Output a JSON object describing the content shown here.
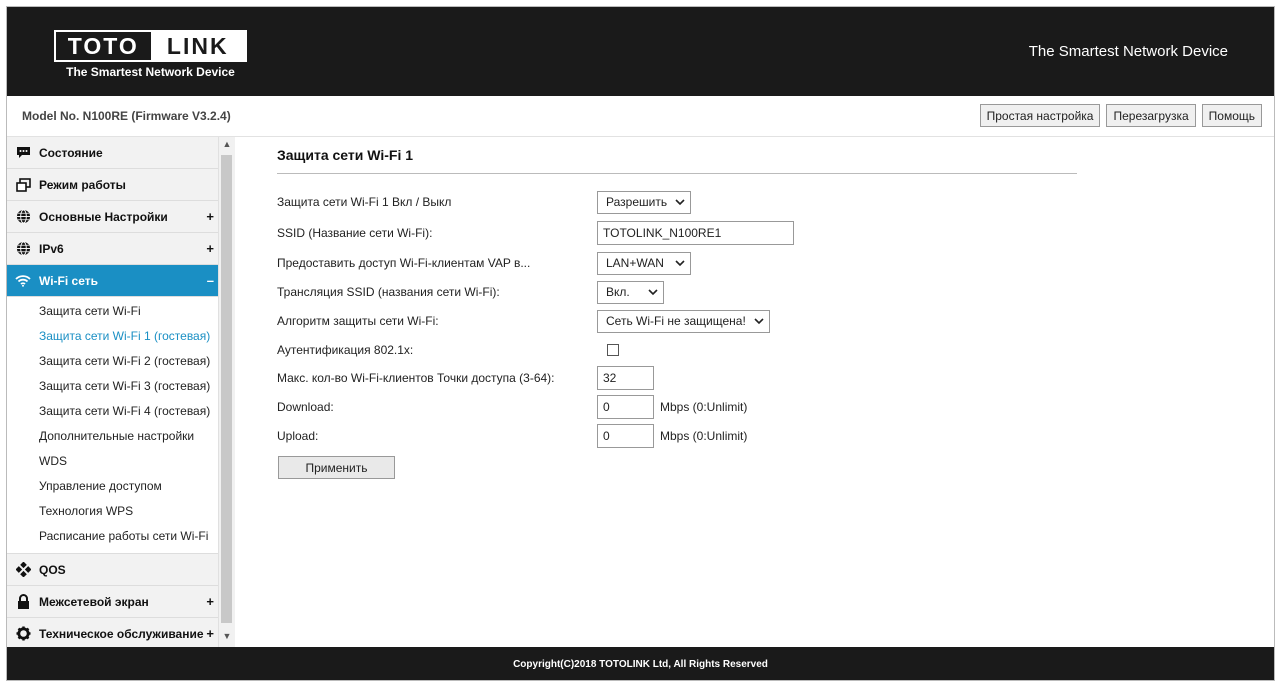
{
  "header": {
    "logo_left": "TOTO",
    "logo_right": "LINK",
    "logo_sub": "The Smartest Network Device",
    "slogan": "The Smartest Network Device"
  },
  "modelbar": {
    "model": "Model No. N100RE (Firmware V3.2.4)",
    "buttons": [
      "Простая настройка",
      "Перезагрузка",
      "Помощь"
    ]
  },
  "sidebar": {
    "items": [
      {
        "label": "Состояние",
        "icon": "chat-icon",
        "expander": ""
      },
      {
        "label": "Режим работы",
        "icon": "windows-icon",
        "expander": ""
      },
      {
        "label": "Основные Настройки",
        "icon": "globe-icon",
        "expander": "+"
      },
      {
        "label": "IPv6",
        "icon": "globe-icon",
        "expander": "+"
      },
      {
        "label": "Wi-Fi сеть",
        "icon": "wifi-icon",
        "expander": "–"
      }
    ],
    "wifi_sub": [
      "Защита сети Wi-Fi",
      "Защита сети Wi-Fi 1 (гостевая)",
      "Защита сети Wi-Fi 2 (гостевая)",
      "Защита сети Wi-Fi 3 (гостевая)",
      "Защита сети Wi-Fi 4 (гостевая)",
      "Дополнительные настройки",
      "WDS",
      "Управление доступом",
      "Технология WPS",
      "Расписание работы сети Wi-Fi"
    ],
    "items_after": [
      {
        "label": "QOS",
        "icon": "qos-icon",
        "expander": ""
      },
      {
        "label": "Межсетевой экран",
        "icon": "lock-icon",
        "expander": "+"
      },
      {
        "label": "Техническое обслуживание",
        "icon": "gear-icon",
        "expander": "+"
      }
    ]
  },
  "content": {
    "title": "Защита сети Wi-Fi 1",
    "rows": [
      {
        "label": "Защита сети Wi-Fi 1 Вкл / Выкл",
        "value": "Разрешить"
      },
      {
        "label": "SSID (Название сети Wi-Fi):",
        "value": "TOTOLINK_N100RE1"
      },
      {
        "label": "Предоставить доступ Wi-Fi-клиентам VAP в...",
        "value": "LAN+WAN"
      },
      {
        "label": "Трансляция SSID (названия сети Wi-Fi):",
        "value": "Вкл."
      },
      {
        "label": "Алгоритм защиты сети Wi-Fi:",
        "value": "Сеть Wi-Fi не защищена!"
      },
      {
        "label": "Аутентификация 802.1x:",
        "value": ""
      },
      {
        "label": "Макс. кол-во Wi-Fi-клиентов Точки доступа (3-64):",
        "value": "32"
      },
      {
        "label": "Download:",
        "value": "0",
        "unit": "Mbps (0:Unlimit)"
      },
      {
        "label": "Upload:",
        "value": "0",
        "unit": "Mbps (0:Unlimit)"
      }
    ],
    "apply": "Применить"
  },
  "footer": {
    "text": "Copyright(C)2018 TOTOLINK Ltd, All Rights Reserved"
  }
}
